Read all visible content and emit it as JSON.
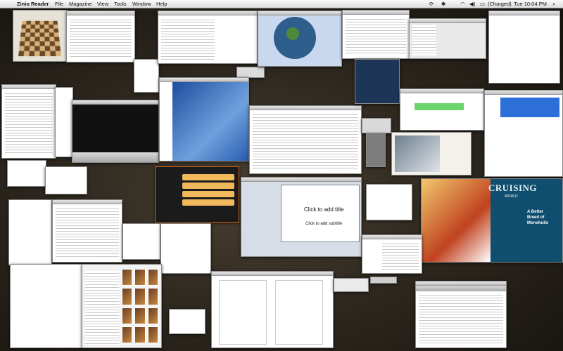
{
  "menubar": {
    "app_name": "Zinio Reader",
    "items": [
      "File",
      "Magazine",
      "View",
      "Tools",
      "Window",
      "Help"
    ],
    "battery": "(Charged)",
    "clock": "Tue 10:04 PM"
  },
  "windows": {
    "keynote": {
      "title_placeholder": "Click to add title",
      "subtitle_placeholder": "Click to add subtitle"
    },
    "magazine": {
      "title": "CRUISING",
      "subtitle": "WORLD",
      "headline1": "A Better",
      "headline2": "Breed of",
      "headline3": "Monohulls"
    }
  }
}
